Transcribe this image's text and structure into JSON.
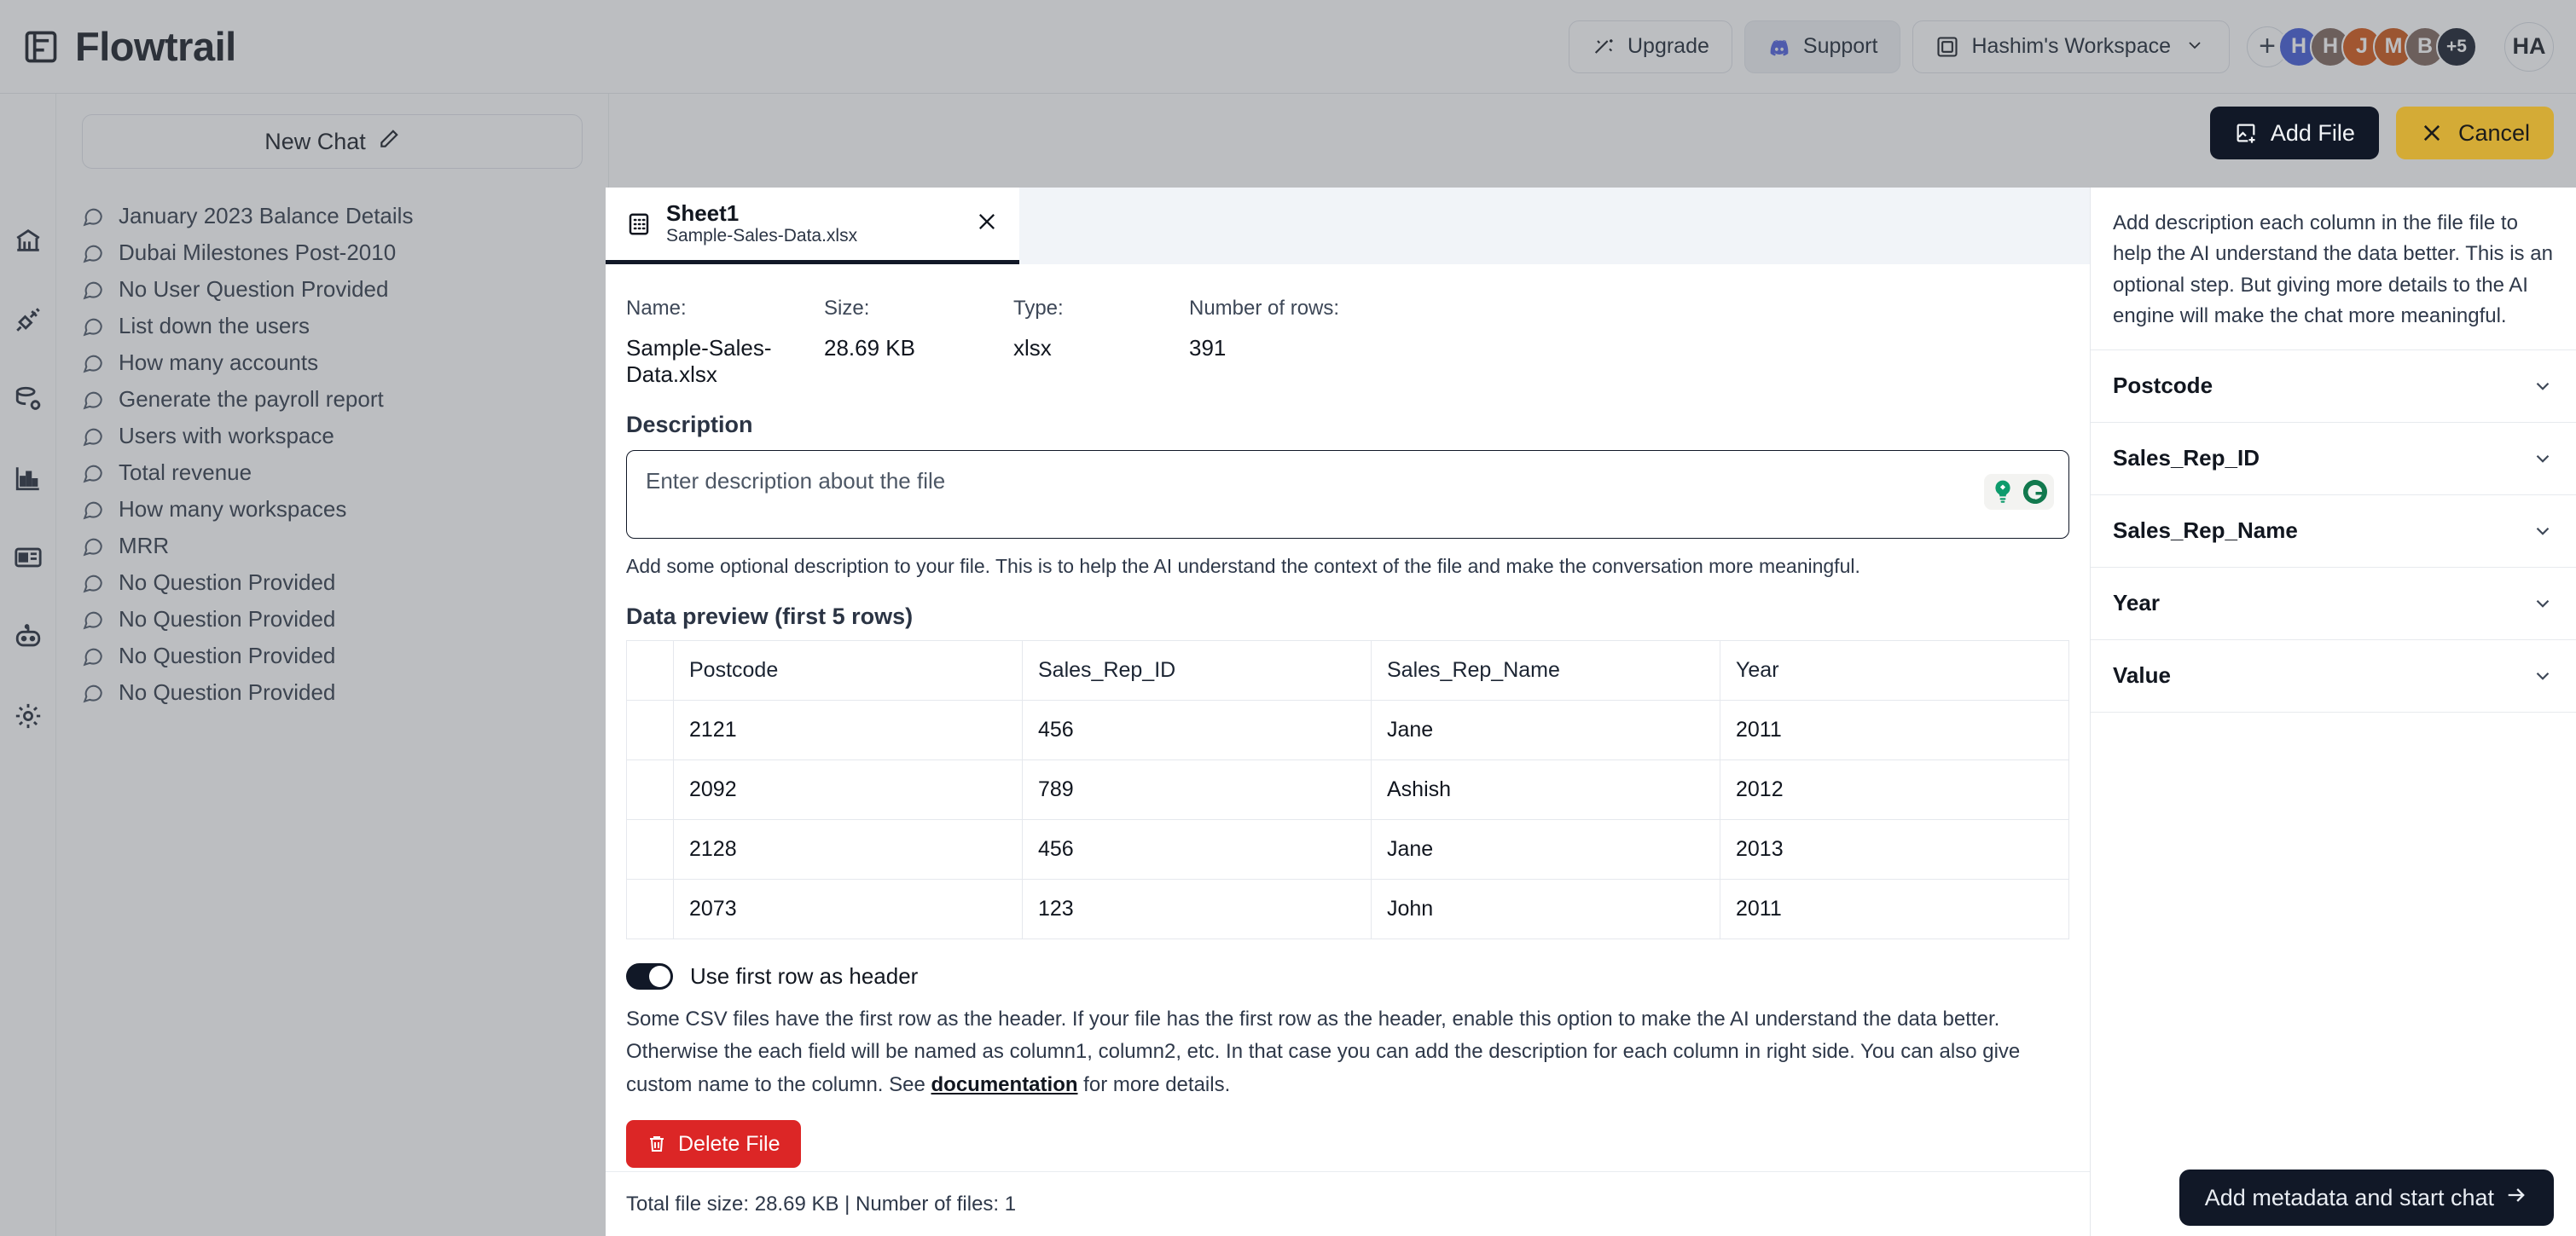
{
  "app": {
    "brand": "Flowtrail",
    "logo_icon": "flowtrail-logo-icon"
  },
  "topbar": {
    "upgrade_label": "Upgrade",
    "upgrade_icon": "sparkles-icon",
    "support_label": "Support",
    "support_icon": "discord-icon",
    "workspace_label": "Hashim's Workspace",
    "workspace_icon": "workspace-icon",
    "workspace_chevron": "chevron-down-icon",
    "add_member_label": "+",
    "avatars": [
      {
        "initial": "H",
        "color": "#3d56d6"
      },
      {
        "initial": "H",
        "color": "#7b6157"
      },
      {
        "initial": "J",
        "color": "#d2520f"
      },
      {
        "initial": "M",
        "color": "#c8500f"
      },
      {
        "initial": "B",
        "color": "#7b6157"
      }
    ],
    "overflow_label": "+5",
    "self_initials": "HA"
  },
  "rail": {
    "items": [
      {
        "name": "bank-icon"
      },
      {
        "name": "plug-icon"
      },
      {
        "name": "database-settings-icon"
      },
      {
        "name": "bar-chart-icon"
      },
      {
        "name": "dashboard-icon"
      },
      {
        "name": "robot-icon"
      },
      {
        "name": "gear-icon"
      }
    ]
  },
  "sidebar": {
    "new_chat_label": "New Chat",
    "new_chat_icon": "pencil-icon",
    "chats": [
      "January 2023 Balance Details",
      "Dubai Milestones Post-2010",
      "No User Question Provided",
      "List down the users",
      "How many accounts",
      "Generate the payroll report",
      "Users with workspace",
      "Total revenue",
      "How many workspaces",
      "MRR",
      "No Question Provided",
      "No Question Provided",
      "No Question Provided",
      "No Question Provided"
    ]
  },
  "actions": {
    "add_file_label": "Add File",
    "add_file_icon": "image-plus-icon",
    "cancel_label": "Cancel",
    "cancel_icon": "close-icon",
    "start_chat_label": "Add metadata and start chat",
    "start_chat_icon": "arrow-right-icon"
  },
  "modal": {
    "tab": {
      "title": "Sheet1",
      "subtitle": "Sample-Sales-Data.xlsx",
      "icon": "spreadsheet-icon",
      "close_icon": "close-icon"
    },
    "meta": [
      {
        "label": "Name:",
        "value": "Sample-Sales-Data.xlsx"
      },
      {
        "label": "Size:",
        "value": "28.69 KB"
      },
      {
        "label": "Type:",
        "value": "xlsx"
      },
      {
        "label": "Number of rows:",
        "value": "391"
      }
    ],
    "description": {
      "title": "Description",
      "placeholder": "Enter description about the file",
      "value": "",
      "tool_icons": [
        "grammarly-suggestion-icon",
        "grammarly-icon"
      ],
      "help": "Add some optional description to your file. This is to help the AI understand the context of the file and make the conversation more meaningful."
    },
    "preview": {
      "title": "Data preview (first 5 rows)",
      "columns": [
        "",
        "Postcode",
        "Sales_Rep_ID",
        "Sales_Rep_Name",
        "Year"
      ],
      "rows": [
        [
          "",
          "2121",
          "456",
          "Jane",
          "2011"
        ],
        [
          "",
          "2092",
          "789",
          "Ashish",
          "2012"
        ],
        [
          "",
          "2128",
          "456",
          "Jane",
          "2013"
        ],
        [
          "",
          "2073",
          "123",
          "John",
          "2011"
        ]
      ]
    },
    "header_toggle": {
      "label": "Use first row as header",
      "enabled": true,
      "para_1": "Some CSV files have the first row as the header. If your file has the first row as the header, enable this option to make the AI understand the data better. Otherwise the each field will be named as column1, column2, etc. In that case you can add the description for each column in right side. You can also give custom name to the column. See ",
      "link_label": "documentation",
      "para_2": " for more details."
    },
    "delete_label": "Delete File",
    "delete_icon": "trash-icon",
    "footer": "Total file size: 28.69 KB | Number of files: 1"
  },
  "right_panel": {
    "help": "Add description each column in the file file to help the AI understand the data better. This is an optional step. But giving more details to the AI engine will make the chat more meaningful.",
    "columns": [
      {
        "name": "Postcode",
        "chevron": "chevron-down-icon"
      },
      {
        "name": "Sales_Rep_ID",
        "chevron": "chevron-down-icon"
      },
      {
        "name": "Sales_Rep_Name",
        "chevron": "chevron-down-icon"
      },
      {
        "name": "Year",
        "chevron": "chevron-down-icon"
      },
      {
        "name": "Value",
        "chevron": "chevron-down-icon"
      }
    ]
  },
  "colors": {
    "accent_dark": "#111827",
    "cancel_yellow": "#d4ab36",
    "danger_red": "#dc2626",
    "scrim": "rgba(88,92,100,0.40)"
  }
}
